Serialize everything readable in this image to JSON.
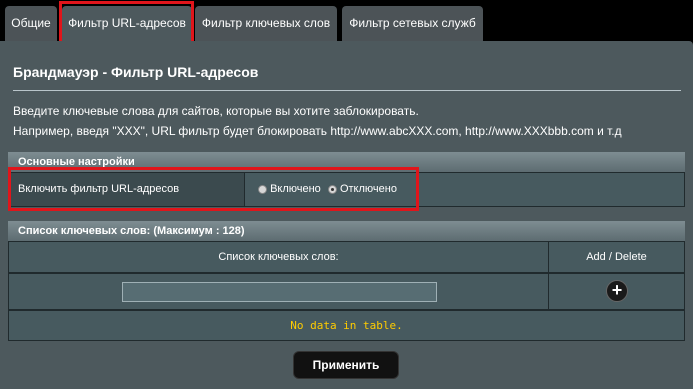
{
  "tabs": [
    {
      "label": "Общие"
    },
    {
      "label": "Фильтр URL-адресов"
    },
    {
      "label": "Фильтр ключевых слов"
    },
    {
      "label": "Фильтр сетевых служб"
    }
  ],
  "page": {
    "title": "Брандмауэр - Фильтр URL-адресов",
    "desc_line1": "Введите ключевые слова для сайтов, которые вы хотите заблокировать.",
    "desc_line2": "Например, введя \"XXX\", URL фильтр будет блокировать http://www.abcXXX.com, http://www.XXXbbb.com и т.д"
  },
  "basic_settings": {
    "header": "Основные настройки",
    "enable_label": "Включить фильтр URL-адресов",
    "option_on": "Включено",
    "option_off": "Отключено",
    "selected": "off"
  },
  "keyword_list": {
    "header": "Список ключевых слов: (Максимум : 128)",
    "col_keywords": "Список ключевых слов:",
    "col_add_delete": "Add / Delete",
    "input_value": "",
    "empty_message": "No data in table."
  },
  "apply_label": "Применить",
  "colors": {
    "highlight": "#e0151b",
    "panel_bg": "#4d595d",
    "empty_text": "#ffcc00"
  }
}
